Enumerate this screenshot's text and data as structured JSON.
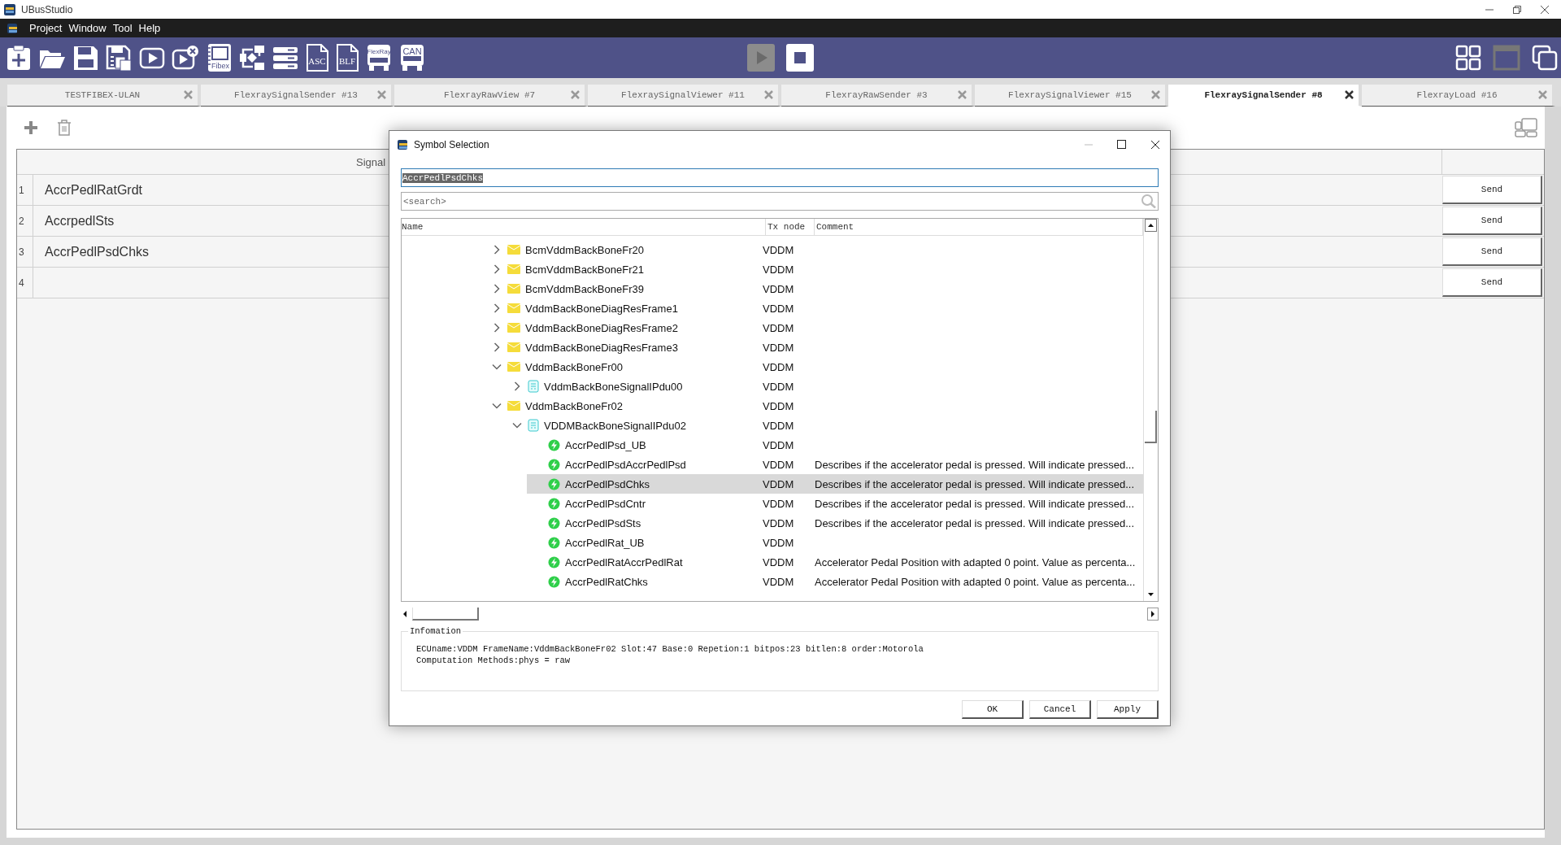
{
  "window": {
    "title": "UBusStudio"
  },
  "menu": [
    "Project",
    "Window",
    "Tool",
    "Help"
  ],
  "toolbar": [
    {
      "kind": "new"
    },
    {
      "kind": "open"
    },
    {
      "kind": "save"
    },
    {
      "kind": "save-all"
    },
    {
      "kind": "play"
    },
    {
      "kind": "play-close"
    },
    {
      "kind": "notebook",
      "label": "Fibex"
    },
    {
      "kind": "flow"
    },
    {
      "kind": "list"
    },
    {
      "kind": "doc",
      "label": "ASC"
    },
    {
      "kind": "doc",
      "label": "BLF"
    },
    {
      "kind": "bus",
      "label": "FlexRay"
    },
    {
      "kind": "bus",
      "label": "CAN"
    }
  ],
  "run_controls": [
    {
      "kind": "run",
      "disabled": true
    },
    {
      "kind": "stop",
      "disabled": false
    }
  ],
  "tabs": [
    {
      "label": "TESTFIBEX-ULAN",
      "selected": false
    },
    {
      "label": "FlexraySignalSender #13",
      "selected": false
    },
    {
      "label": "FlexrayRawView #7",
      "selected": false
    },
    {
      "label": "FlexraySignalViewer #11",
      "selected": false
    },
    {
      "label": "FlexrayRawSender #3",
      "selected": false
    },
    {
      "label": "FlexraySignalViewer #15",
      "selected": false
    },
    {
      "label": "FlexraySignalSender #8",
      "selected": true
    },
    {
      "label": "FlexrayLoad #16",
      "selected": false
    }
  ],
  "signal_table": {
    "column": "Signal",
    "rows": [
      {
        "number": "1",
        "signal": "AccrPedlRatGrdt",
        "action": "Send"
      },
      {
        "number": "2",
        "signal": "AccrpedlSts",
        "action": "Send"
      },
      {
        "number": "3",
        "signal": "AccrPedlPsdChks",
        "action": "Send"
      },
      {
        "number": "4",
        "action": "Send"
      }
    ]
  },
  "dialog": {
    "title": "Symbol Selection",
    "value": "AccrPedlPsdChks",
    "search": {
      "placeholder": "<search>"
    },
    "columns": [
      "Name",
      "Tx node",
      "Comment"
    ],
    "tree": [
      {
        "kind": "frame",
        "name": "BcmVddmBackBoneFr20",
        "tx_node": "VDDM",
        "expanded": false,
        "selected": false
      },
      {
        "kind": "frame",
        "name": "BcmVddmBackBoneFr21",
        "tx_node": "VDDM",
        "expanded": false,
        "selected": false
      },
      {
        "kind": "frame",
        "name": "BcmVddmBackBoneFr39",
        "tx_node": "VDDM",
        "expanded": false,
        "selected": false
      },
      {
        "kind": "frame",
        "name": "VddmBackBoneDiagResFrame1",
        "tx_node": "VDDM",
        "expanded": false,
        "selected": false
      },
      {
        "kind": "frame",
        "name": "VddmBackBoneDiagResFrame2",
        "tx_node": "VDDM",
        "expanded": false,
        "selected": false
      },
      {
        "kind": "frame",
        "name": "VddmBackBoneDiagResFrame3",
        "tx_node": "VDDM",
        "expanded": false,
        "selected": false
      },
      {
        "kind": "frame",
        "name": "VddmBackBoneFr00",
        "tx_node": "VDDM",
        "expanded": true,
        "selected": false,
        "children": [
          {
            "kind": "pdu",
            "name": "VddmBackBoneSignalIPdu00",
            "tx_node": "VDDM",
            "expanded": false,
            "selected": false
          }
        ]
      },
      {
        "kind": "frame",
        "name": "VddmBackBoneFr02",
        "tx_node": "VDDM",
        "expanded": true,
        "selected": false,
        "children": [
          {
            "kind": "pdu",
            "name": "VDDMBackBoneSignalIPdu02",
            "tx_node": "VDDM",
            "expanded": true,
            "selected": false,
            "children": [
              {
                "kind": "signal",
                "name": "AccrPedlPsd_UB",
                "tx_node": "VDDM",
                "selected": false
              },
              {
                "kind": "signal",
                "name": "AccrPedlPsdAccrPedlPsd",
                "tx_node": "VDDM",
                "comment": "Describes if the accelerator pedal is pressed. Will indicate pressed...",
                "selected": false
              },
              {
                "kind": "signal",
                "name": "AccrPedlPsdChks",
                "tx_node": "VDDM",
                "comment": "Describes if the accelerator pedal is pressed. Will indicate pressed...",
                "selected": true
              },
              {
                "kind": "signal",
                "name": "AccrPedlPsdCntr",
                "tx_node": "VDDM",
                "comment": "Describes if the accelerator pedal is pressed. Will indicate pressed...",
                "selected": false
              },
              {
                "kind": "signal",
                "name": "AccrPedlPsdSts",
                "tx_node": "VDDM",
                "comment": "Describes if the accelerator pedal is pressed. Will indicate pressed...",
                "selected": false
              },
              {
                "kind": "signal",
                "name": "AccrPedlRat_UB",
                "tx_node": "VDDM",
                "selected": false
              },
              {
                "kind": "signal",
                "name": "AccrPedlRatAccrPedlRat",
                "tx_node": "VDDM",
                "comment": "Accelerator Pedal Position with adapted 0 point. Value as percenta...",
                "selected": false
              },
              {
                "kind": "signal",
                "name": "AccrPedlRatChks",
                "tx_node": "VDDM",
                "comment": "Accelerator Pedal Position with adapted 0 point. Value as percenta...",
                "selected": false
              }
            ]
          }
        ]
      }
    ],
    "info": {
      "title": "Infomation",
      "lines": [
        "ECUname:VDDM FrameName:VddmBackBoneFr02 Slot:47 Base:0 Repetion:1 bitpos:23 bitlen:8 order:Motorola",
        "Computation Methods:phys = raw"
      ]
    },
    "buttons": [
      "OK",
      "Cancel",
      "Apply"
    ]
  }
}
